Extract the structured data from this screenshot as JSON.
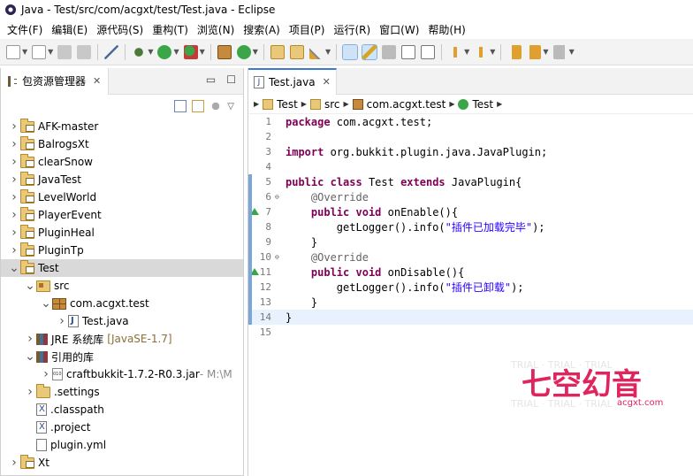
{
  "window": {
    "title": "Java  -  Test/src/com/acgxt/test/Test.java  -  Eclipse"
  },
  "menu": [
    "文件(F)",
    "编辑(E)",
    "源代码(S)",
    "重构(T)",
    "浏览(N)",
    "搜索(A)",
    "项目(P)",
    "运行(R)",
    "窗口(W)",
    "帮助(H)"
  ],
  "left_panel": {
    "tab_label": "包资源管理器",
    "items": [
      {
        "label": "AFK-master",
        "indent": 0,
        "arrow": "closed",
        "icon": "project-folder-icon"
      },
      {
        "label": "BalrogsXt",
        "indent": 0,
        "arrow": "closed",
        "icon": "project-folder-icon"
      },
      {
        "label": "clearSnow",
        "indent": 0,
        "arrow": "closed",
        "icon": "project-folder-icon"
      },
      {
        "label": "JavaTest",
        "indent": 0,
        "arrow": "closed",
        "icon": "project-folder-icon"
      },
      {
        "label": "LevelWorld",
        "indent": 0,
        "arrow": "closed",
        "icon": "project-folder-icon"
      },
      {
        "label": "PlayerEvent",
        "indent": 0,
        "arrow": "closed",
        "icon": "project-folder-icon"
      },
      {
        "label": "PluginHeal",
        "indent": 0,
        "arrow": "closed",
        "icon": "project-folder-icon"
      },
      {
        "label": "PluginTp",
        "indent": 0,
        "arrow": "closed",
        "icon": "project-folder-icon"
      },
      {
        "label": "Test",
        "indent": 0,
        "arrow": "open",
        "icon": "project-folder-icon",
        "selected": true
      },
      {
        "label": "src",
        "indent": 1,
        "arrow": "open",
        "icon": "source-folder-icon"
      },
      {
        "label": "com.acgxt.test",
        "indent": 2,
        "arrow": "open",
        "icon": "package-icon"
      },
      {
        "label": "Test.java",
        "indent": 3,
        "arrow": "closed",
        "icon": "java-file-icon"
      },
      {
        "label": "JRE 系统库",
        "extra": "[JavaSE-1.7]",
        "indent": 1,
        "arrow": "closed",
        "icon": "library-icon"
      },
      {
        "label": "引用的库",
        "indent": 1,
        "arrow": "open",
        "icon": "library-icon"
      },
      {
        "label": "craftbukkit-1.7.2-R0.3.jar",
        "extra": " - M:\\M",
        "indent": 2,
        "arrow": "closed",
        "icon": "jar-icon"
      },
      {
        "label": ".settings",
        "indent": 1,
        "arrow": "closed",
        "icon": "folder-icon"
      },
      {
        "label": ".classpath",
        "indent": 1,
        "arrow": "none",
        "icon": "xml-file-icon"
      },
      {
        "label": ".project",
        "indent": 1,
        "arrow": "none",
        "icon": "xml-file-icon"
      },
      {
        "label": "plugin.yml",
        "indent": 1,
        "arrow": "none",
        "icon": "text-file-icon"
      },
      {
        "label": "Xt",
        "indent": 0,
        "arrow": "closed",
        "icon": "project-folder-icon"
      }
    ]
  },
  "editor": {
    "tab_label": "Test.java",
    "breadcrumb": [
      "Test",
      "src",
      "com.acgxt.test",
      "Test"
    ],
    "lines": [
      {
        "n": "1",
        "code": [
          [
            "kw",
            "package"
          ],
          [
            "",
            " com.acgxt.test;"
          ]
        ]
      },
      {
        "n": "2",
        "code": []
      },
      {
        "n": "3",
        "code": [
          [
            "kw",
            "import"
          ],
          [
            "",
            " org.bukkit.plugin.java.JavaPlugin;"
          ]
        ]
      },
      {
        "n": "4",
        "code": []
      },
      {
        "n": "5",
        "code": [
          [
            "kw",
            "public"
          ],
          [
            "",
            " "
          ],
          [
            "kw",
            "class"
          ],
          [
            "",
            " Test "
          ],
          [
            "kw",
            "extends"
          ],
          [
            "",
            " JavaPlugin{"
          ]
        ]
      },
      {
        "n": "6",
        "fold": "−",
        "code": [
          [
            "",
            "    "
          ],
          [
            "ann",
            "@Override"
          ]
        ]
      },
      {
        "n": "7",
        "code": [
          [
            "",
            "    "
          ],
          [
            "kw",
            "public"
          ],
          [
            "",
            " "
          ],
          [
            "kw",
            "void"
          ],
          [
            "",
            " onEnable(){"
          ]
        ]
      },
      {
        "n": "8",
        "code": [
          [
            "",
            "        getLogger().info("
          ],
          [
            "str",
            "\"插件已加载完毕\""
          ],
          [
            "",
            ");"
          ]
        ]
      },
      {
        "n": "9",
        "code": [
          [
            "",
            "    }"
          ]
        ]
      },
      {
        "n": "10",
        "fold": "−",
        "code": [
          [
            "",
            "    "
          ],
          [
            "ann",
            "@Override"
          ]
        ]
      },
      {
        "n": "11",
        "code": [
          [
            "",
            "    "
          ],
          [
            "kw",
            "public"
          ],
          [
            "",
            " "
          ],
          [
            "kw",
            "void"
          ],
          [
            "",
            " onDisable(){"
          ]
        ]
      },
      {
        "n": "12",
        "code": [
          [
            "",
            "        getLogger().info("
          ],
          [
            "str",
            "\"插件已卸载\""
          ],
          [
            "",
            ");"
          ]
        ]
      },
      {
        "n": "13",
        "code": [
          [
            "",
            "    }"
          ]
        ]
      },
      {
        "n": "14",
        "cur": true,
        "code": [
          [
            "",
            "}"
          ]
        ]
      },
      {
        "n": "15",
        "code": []
      }
    ]
  },
  "watermark": {
    "logo_text": "七空幻音",
    "site": "acgxt.com",
    "trial": "TRIAL"
  }
}
